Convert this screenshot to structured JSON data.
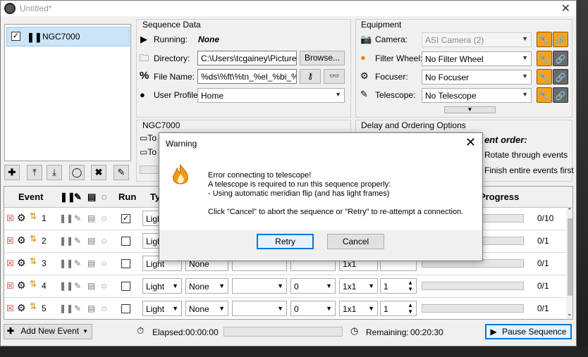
{
  "window": {
    "title": "Untitled*",
    "close_glyph": "✕"
  },
  "sequence_list": {
    "items": [
      {
        "name": "NGC7000",
        "checked": true
      }
    ]
  },
  "list_tools": [
    "add-icon",
    "move-up-icon",
    "move-down-icon",
    "reset-icon",
    "delete-icon",
    "edit-icon"
  ],
  "sequence_data": {
    "header": "Sequence Data",
    "running_label": "Running:",
    "running_value": "None",
    "directory_label": "Directory:",
    "directory_value": "C:\\Users\\tcgainey\\Pictures\\",
    "browse_label": "Browse...",
    "filename_label": "File Name:",
    "filename_value": "%ds\\%ft\\%tn_%el_%bi_%su_",
    "profile_label": "User Profile:",
    "profile_value": "Home"
  },
  "equipment": {
    "header": "Equipment",
    "camera_label": "Camera:",
    "camera_value": "ASI Camera (2)",
    "filter_label": "Filter Wheel:",
    "filter_value": "No Filter Wheel",
    "focuser_label": "Focuser:",
    "focuser_value": "No Focuser",
    "telescope_label": "Telescope:",
    "telescope_value": "No Telescope"
  },
  "target_panel": {
    "header": "NGC7000",
    "row1": "To",
    "row2": "To"
  },
  "delay_panel": {
    "header": "Delay and Ordering Options",
    "order_label": "ent order:",
    "opt1": "Rotate through events",
    "opt2": "Finish entire events first"
  },
  "grid": {
    "headers": {
      "event": "Event",
      "run": "Run",
      "type": "Ty",
      "progress": "Progress"
    },
    "rows": [
      {
        "num": "1",
        "run": true,
        "type": "Light",
        "binning": "",
        "exposure": "",
        "progress": "0/10",
        "full": false
      },
      {
        "num": "2",
        "run": false,
        "type": "Light",
        "binning": "",
        "exposure": "",
        "progress": "0/1",
        "full": false
      },
      {
        "num": "3",
        "run": false,
        "type": "Light",
        "filter": "None",
        "binning": "1x1",
        "progress": "0/1",
        "full": false
      },
      {
        "num": "4",
        "run": false,
        "type": "Light",
        "filter": "None",
        "delay": "0",
        "binning": "1x1",
        "count": "1",
        "progress": "0/1",
        "full": true
      },
      {
        "num": "5",
        "run": false,
        "type": "Light",
        "filter": "None",
        "delay": "0",
        "binning": "1x1",
        "count": "1",
        "progress": "0/1",
        "full": true
      }
    ]
  },
  "footer": {
    "add_event": "Add New Event",
    "elapsed_label": "Elapsed:",
    "elapsed_value": "00:00:00",
    "remaining_label": "Remaining:",
    "remaining_value": "00:20:30",
    "pause_label": "Pause Sequence"
  },
  "dialog": {
    "title": "Warning",
    "line1": "Error connecting to telescope!",
    "line2": "A telescope is required to run this sequence properly:",
    "line3": "- Using automatic meridian flip (and has light frames)",
    "line4": "Click \"Cancel\" to abort the sequence or \"Retry\" to re-attempt a connection.",
    "retry": "Retry",
    "cancel": "Cancel"
  }
}
